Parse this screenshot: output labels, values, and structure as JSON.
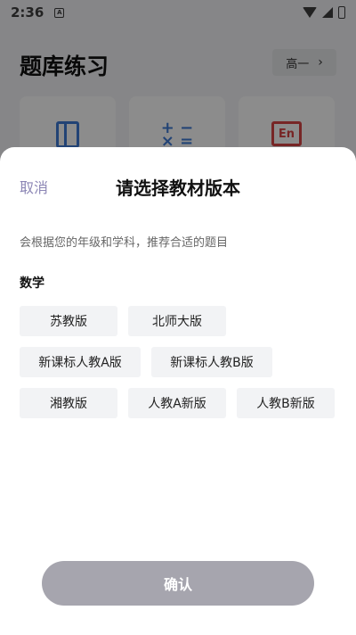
{
  "status": {
    "time": "2:36",
    "notif_glyph": "A"
  },
  "background": {
    "title": "题库练习",
    "grade_label": "高一",
    "cards": [
      {
        "icon": "book-icon"
      },
      {
        "icon": "math-icon",
        "glyph": "+−\n×="
      },
      {
        "icon": "english-icon",
        "glyph": "En"
      }
    ]
  },
  "sheet": {
    "cancel_label": "取消",
    "title": "请选择教材版本",
    "hint": "会根据您的年级和学科，推荐合适的题目",
    "subject": "数学",
    "options": [
      "苏教版",
      "北师大版",
      "新课标人教A版",
      "新课标人教B版",
      "湘教版",
      "人教A新版",
      "人教B新版"
    ],
    "confirm_label": "确认"
  }
}
